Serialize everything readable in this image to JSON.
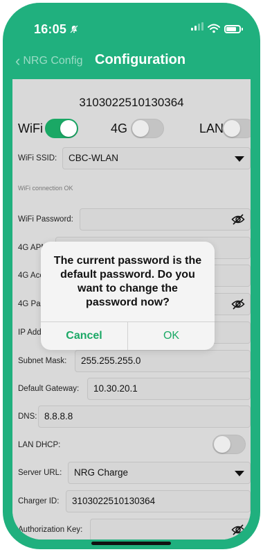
{
  "status": {
    "time": "16:05",
    "silent_icon": "bell-slash-icon"
  },
  "nav": {
    "back_label": "NRG Config",
    "title": "Configuration"
  },
  "device": {
    "serial": "3103022510130364"
  },
  "toggles": {
    "wifi": {
      "label": "WiFi",
      "on": true
    },
    "g4": {
      "label": "4G",
      "on": false
    },
    "lan": {
      "label": "LAN",
      "on": false
    }
  },
  "fields": {
    "wifi_ssid": {
      "label": "WiFi SSID:",
      "value": "CBC-WLAN"
    },
    "wifi_note": "WiFi connection OK",
    "wifi_password": {
      "label": "WiFi Password:",
      "value": ""
    },
    "apn": {
      "label": "4G APN:"
    },
    "account": {
      "label": "4G Acco"
    },
    "g4_password": {
      "label": "4G Pass"
    },
    "ip_address": {
      "label": "IP Addre"
    },
    "subnet_mask": {
      "label": "Subnet Mask:",
      "value": "255.255.255.0"
    },
    "gateway": {
      "label": "Default Gateway:",
      "value": "10.30.20.1"
    },
    "dns": {
      "label": "DNS:",
      "value": "8.8.8.8"
    },
    "lan_dhcp": {
      "label": "LAN DHCP:",
      "on": false
    },
    "server_url": {
      "label": "Server URL:",
      "value": "NRG Charge"
    },
    "charger_id": {
      "label": "Charger ID:",
      "value": "3103022510130364"
    },
    "auth_key": {
      "label": "Authorization Key:",
      "value": ""
    }
  },
  "dialog": {
    "message": "The current password is the default password. Do you want to change the password now?",
    "cancel_label": "Cancel",
    "ok_label": "OK"
  },
  "colors": {
    "brand_green": "#20b07e",
    "switch_on": "#1aa865",
    "background": "#d9d9d9"
  }
}
